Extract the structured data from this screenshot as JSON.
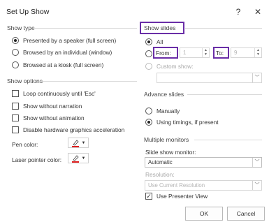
{
  "dialog": {
    "title": "Set Up Show",
    "help": "?",
    "close": "✕"
  },
  "show_type": {
    "title": "Show type",
    "options": [
      {
        "label": "Presented by a speaker (full screen)",
        "selected": true
      },
      {
        "label": "Browsed by an individual (window)",
        "selected": false
      },
      {
        "label": "Browsed at a kiosk (full screen)",
        "selected": false
      }
    ]
  },
  "show_options": {
    "title": "Show options",
    "loop": "Loop continuously until 'Esc'",
    "no_narration": "Show without narration",
    "no_animation": "Show without animation",
    "disable_hw": "Disable hardware graphics acceleration",
    "pen_color": "Pen color:",
    "laser_color": "Laser pointer color:",
    "pen_color_value": "#e02020",
    "laser_color_value": "#e02020"
  },
  "show_slides": {
    "title": "Show slides",
    "all": "All",
    "from": "From:",
    "from_value": "1",
    "to": "To:",
    "to_value": "9",
    "custom": "Custom show:"
  },
  "advance": {
    "title": "Advance slides",
    "manually": "Manually",
    "timings": "Using timings, if present"
  },
  "monitors": {
    "title": "Multiple monitors",
    "slide_show_monitor": "Slide show monitor:",
    "monitor_value": "Automatic",
    "resolution": "Resolution:",
    "resolution_value": "Use Current Resolution",
    "presenter_view": "Use Presenter View"
  },
  "buttons": {
    "ok": "OK",
    "cancel": "Cancel"
  },
  "colors": {
    "highlight": "#6a2ea7"
  }
}
